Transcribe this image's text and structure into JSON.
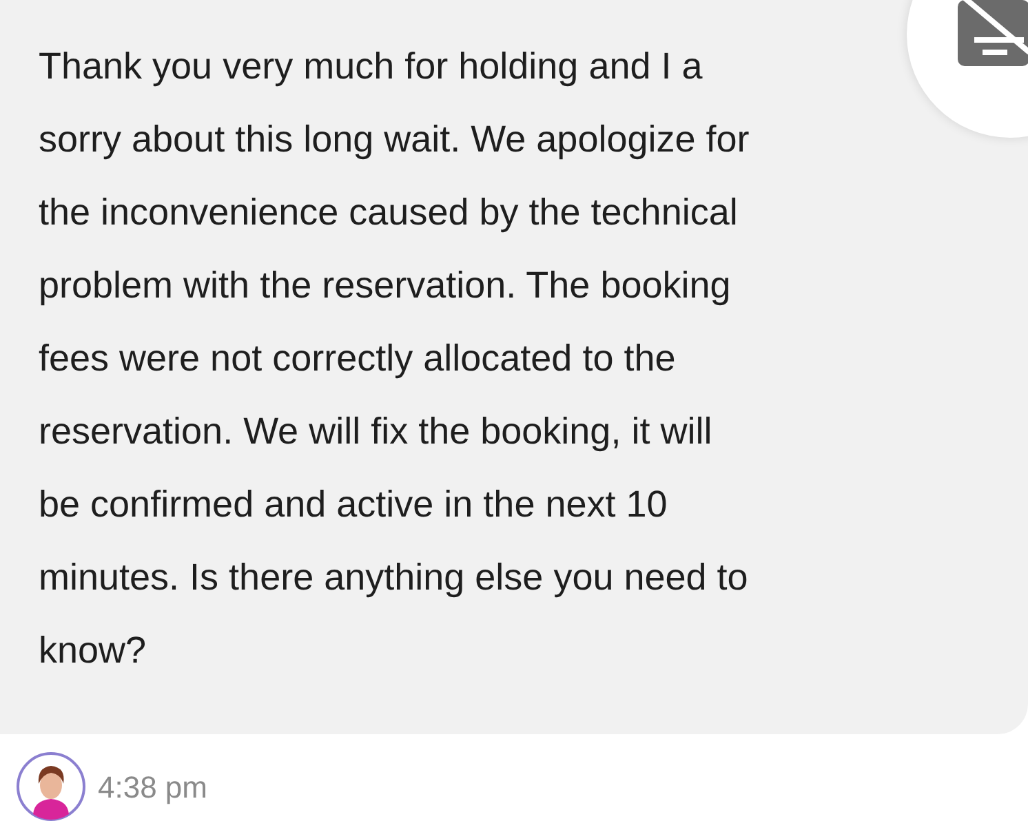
{
  "message": {
    "text": "Thank you very much for holding and I a\nsorry about this long wait. We apologize for\nthe inconvenience caused by the technical\nproblem with the reservation. The booking\nfees were not correctly allocated to the\nreservation. We will fix the booking, it will\nbe confirmed and active in the next 10\nminutes. Is there anything else you need to\nknow?",
    "time": "4:38 pm"
  }
}
